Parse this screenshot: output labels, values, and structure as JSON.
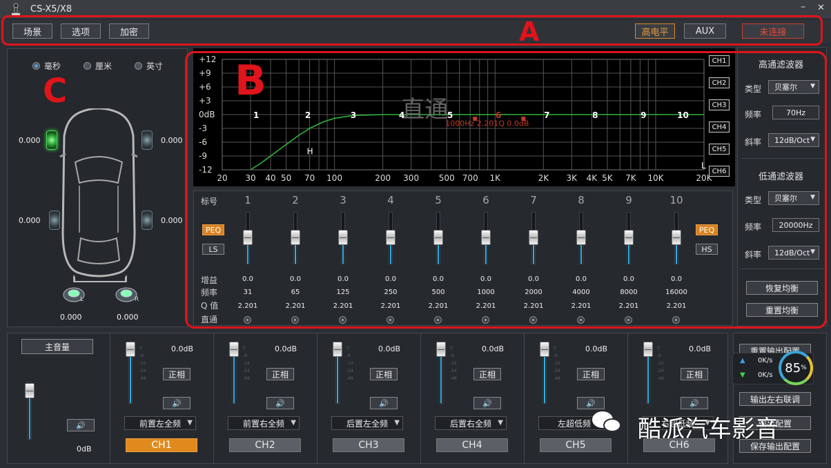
{
  "app": {
    "title": "CS-X5/X8",
    "minimize": "–",
    "close": "✕"
  },
  "menu": {
    "buttons": [
      "场景",
      "选项",
      "加密"
    ],
    "level_label": "高电平",
    "aux_label": "AUX",
    "conn_label": "未连接"
  },
  "delay": {
    "units": [
      "毫秒",
      "厘米",
      "英寸"
    ],
    "selected_unit": "毫秒",
    "values": {
      "front_left": "0.000",
      "front_right": "0.000",
      "rear_left": "0.000",
      "rear_right": "0.000",
      "sub_left": "0.000",
      "sub_right": "0.000"
    },
    "sub_left_tag": "L",
    "sub_right_tag": "R"
  },
  "graph": {
    "y_ticks": [
      "+12",
      "+9",
      "+6",
      "+3",
      "0dB",
      "-3",
      "-6",
      "-9",
      "-12"
    ],
    "x_ticks": [
      "20",
      "30",
      "40",
      "50",
      "70",
      "100",
      "200",
      "300",
      "500",
      "700",
      "1K",
      "2K",
      "3K",
      "4K",
      "5K",
      "7K",
      "10K",
      "20K"
    ],
    "points": [
      "1",
      "2",
      "3",
      "4",
      "5",
      "6",
      "7",
      "8",
      "9",
      "10"
    ],
    "bypass_text": "直通",
    "point_info": "1000Hz 2.201Q 0.0dB",
    "hp_marker": "H",
    "lp_marker": "L",
    "channels": [
      "CH1",
      "CH2",
      "CH3",
      "CH4",
      "CH5",
      "CH6"
    ],
    "colors": {
      "curve": "#2fb53a",
      "marker": "#c0392b",
      "background": "#000000"
    }
  },
  "chart_data": {
    "type": "line",
    "title": "",
    "xlabel": "",
    "ylabel": "",
    "x_scale": "log",
    "xlim": [
      20,
      20000
    ],
    "ylim": [
      -12,
      12
    ],
    "grid": true,
    "series": [
      {
        "values_x": [
          30,
          35,
          40,
          50,
          60,
          70,
          85,
          100,
          130,
          200,
          20000
        ],
        "values_y": [
          -12,
          -10.5,
          -9,
          -6.5,
          -4.5,
          -3,
          -1.6,
          -0.8,
          -0.2,
          0,
          0
        ]
      }
    ],
    "eq_points": [
      {
        "label": "1",
        "freq": 31,
        "gain": 0.0
      },
      {
        "label": "2",
        "freq": 65,
        "gain": 0.0
      },
      {
        "label": "3",
        "freq": 125,
        "gain": 0.0
      },
      {
        "label": "4",
        "freq": 250,
        "gain": 0.0
      },
      {
        "label": "5",
        "freq": 500,
        "gain": 0.0
      },
      {
        "label": "6",
        "freq": 1000,
        "gain": 0.0
      },
      {
        "label": "7",
        "freq": 2000,
        "gain": 0.0
      },
      {
        "label": "8",
        "freq": 4000,
        "gain": 0.0
      },
      {
        "label": "9",
        "freq": 8000,
        "gain": 0.0
      },
      {
        "label": "10",
        "freq": 16000,
        "gain": 0.0
      }
    ]
  },
  "filters": {
    "highpass_title": "高通滤波器",
    "lowpass_title": "低通滤波器",
    "type_label": "类型",
    "freq_label": "频率",
    "slope_label": "斜率",
    "hp_type": "贝塞尔",
    "hp_freq": "70Hz",
    "hp_slope": "12dB/Oct",
    "lp_type": "贝塞尔",
    "lp_freq": "20000Hz",
    "lp_slope": "12dB/Oct",
    "restore_eq": "恢复均衡",
    "reset_eq": "重置均衡"
  },
  "eq": {
    "label_header": "标号",
    "gain_label": "增益",
    "freq_label": "频率",
    "q_label": "Q 值",
    "bypass_label": "直通",
    "peq_left": "PEQ",
    "ls": "LS",
    "peq_right": "PEQ",
    "hs": "HS",
    "bands": [
      {
        "num": "1",
        "gain": "0.0",
        "freq": "31",
        "q": "2.201"
      },
      {
        "num": "2",
        "gain": "0.0",
        "freq": "65",
        "q": "2.201"
      },
      {
        "num": "3",
        "gain": "0.0",
        "freq": "125",
        "q": "2.201"
      },
      {
        "num": "4",
        "gain": "0.0",
        "freq": "250",
        "q": "2.201"
      },
      {
        "num": "5",
        "gain": "0.0",
        "freq": "500",
        "q": "2.201"
      },
      {
        "num": "6",
        "gain": "0.0",
        "freq": "1000",
        "q": "2.201"
      },
      {
        "num": "7",
        "gain": "0.0",
        "freq": "2000",
        "q": "2.201"
      },
      {
        "num": "8",
        "gain": "0.0",
        "freq": "4000",
        "q": "2.201"
      },
      {
        "num": "9",
        "gain": "0.0",
        "freq": "8000",
        "q": "2.201"
      },
      {
        "num": "10",
        "gain": "0.0",
        "freq": "16000",
        "q": "2.201"
      }
    ]
  },
  "outputs": {
    "master_label": "主音量",
    "master_db": "0dB",
    "channels": [
      {
        "db": "0.0dB",
        "phase": "正相",
        "name": "前置左全频",
        "tag": "CH1",
        "selected": true
      },
      {
        "db": "0.0dB",
        "phase": "正相",
        "name": "前置右全频",
        "tag": "CH2",
        "selected": false
      },
      {
        "db": "0.0dB",
        "phase": "正相",
        "name": "后置左全频",
        "tag": "CH3",
        "selected": false
      },
      {
        "db": "0.0dB",
        "phase": "正相",
        "name": "后置右全频",
        "tag": "CH4",
        "selected": false
      },
      {
        "db": "0.0dB",
        "phase": "正相",
        "name": "左超低频",
        "tag": "CH5",
        "selected": false
      },
      {
        "db": "0.0dB",
        "phase": "正相",
        "name": "右超低频",
        "tag": "CH6",
        "selected": false
      }
    ],
    "tick_labels": [
      "0",
      "-6",
      "-12",
      "-24",
      "-48"
    ],
    "speaker_glyph": "🔊"
  },
  "right_actions": {
    "reset_out": "重置输出配置",
    "link_lr": "输出左右联调",
    "save_out": "保存输出配置",
    "mid_btn": "输出配置",
    "net_up": "0K/s",
    "net_down": "0K/s",
    "net_percent": "85",
    "net_percent_unit": "%"
  },
  "annotations": {
    "a": "A",
    "b": "B",
    "c": "C"
  },
  "watermark": "酷派汽车影音"
}
